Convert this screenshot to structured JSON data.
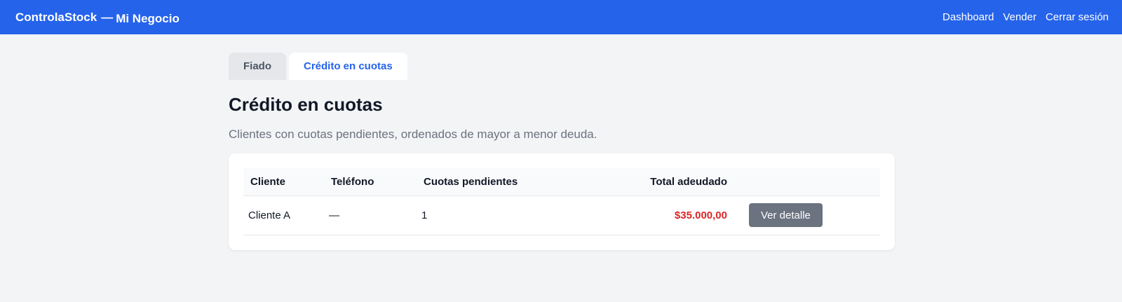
{
  "header": {
    "brand_name": "ControlaStock",
    "brand_separator": "—",
    "business_name": "Mi Negocio",
    "nav": [
      "Dashboard",
      "Vender",
      "Cerrar sesión"
    ]
  },
  "tabs": [
    {
      "label": "Fiado",
      "active": false
    },
    {
      "label": "Crédito en cuotas",
      "active": true
    }
  ],
  "page": {
    "title": "Crédito en cuotas",
    "subtitle": "Clientes con cuotas pendientes, ordenados de mayor a menor deuda."
  },
  "table": {
    "columns": [
      "Cliente",
      "Teléfono",
      "Cuotas pendientes",
      "Total adeudado",
      ""
    ],
    "rows": [
      {
        "cliente": "Cliente A",
        "telefono": "—",
        "cuotas": "1",
        "total": "$35.000,00",
        "action": "Ver detalle"
      }
    ]
  },
  "colors": {
    "primary": "#2563eb",
    "debt": "#dc2626",
    "button": "#6b7280",
    "background": "#f3f4f6"
  }
}
